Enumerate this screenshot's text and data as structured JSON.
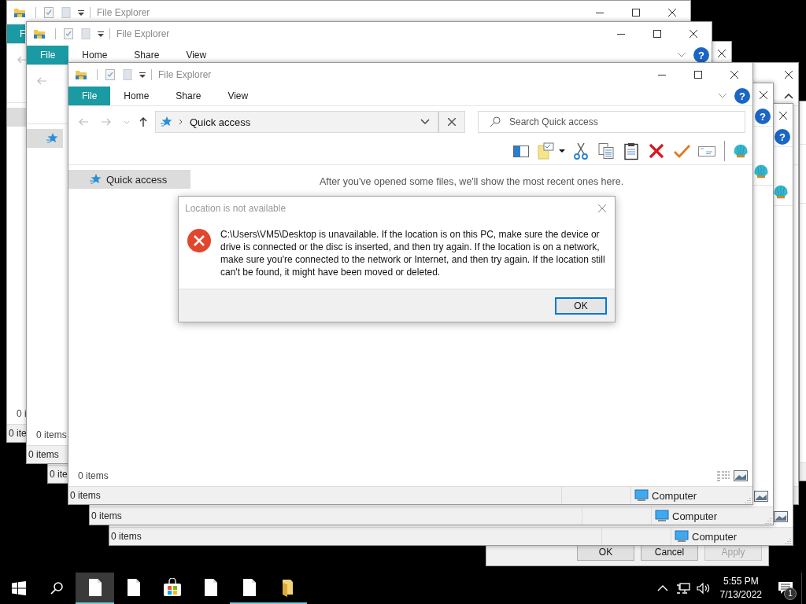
{
  "desktop": {
    "windows": [
      {
        "kind": "explorer",
        "title": "File Explorer",
        "min_button": true,
        "max_button": true,
        "close_button": true,
        "tabs": [
          {
            "label": "File",
            "selected": true
          },
          {
            "label": "Home",
            "selected": false
          },
          {
            "label": "Share",
            "selected": false
          },
          {
            "label": "View",
            "selected": false
          }
        ],
        "ribbon_collapse": true,
        "help": "?",
        "back_button": true,
        "address": "Quick access",
        "search": {
          "placeholder": "Search Quick access"
        },
        "toolbar": [
          {
            "kind": "preview-pane"
          },
          {
            "kind": "folder-note"
          },
          {
            "kind": "caret"
          },
          {
            "kind": "scissors"
          },
          {
            "kind": "copy"
          },
          {
            "kind": "paste"
          },
          {
            "kind": "delete"
          },
          {
            "kind": "check"
          },
          {
            "kind": "envelope"
          },
          {
            "kind": "separator"
          },
          {
            "kind": "shell"
          }
        ],
        "sidebar": {
          "label": "Quick access",
          "selected": true,
          "icon": true
        },
        "message": "After you've opened some files, we'll show the most recent ones here.",
        "content_status": "0 items",
        "details_icon": true,
        "image_icon": true,
        "status": "0 items",
        "computer": "Computer",
        "resize_grip": true
      },
      {
        "kind": "explorer",
        "close_button": true,
        "help": "?",
        "toolbar": [
          {
            "kind": "shell"
          }
        ],
        "image_icon": true,
        "status": "0 items",
        "computer": "Computer",
        "resize_grip": true
      },
      {
        "kind": "explorer",
        "close_button": true,
        "help": "?",
        "toolbar": [
          {
            "kind": "shell"
          }
        ],
        "image_icon": true,
        "status": "0 items",
        "computer": "Computer",
        "resize_grip": true
      },
      {
        "kind": "explorer",
        "title": "File Explorer",
        "min_button": true,
        "max_button": true,
        "close_button": true,
        "tabs": [
          {
            "label": "File",
            "selected": true
          },
          {
            "label": "Home",
            "selected": false
          },
          {
            "label": "Share",
            "selected": false
          },
          {
            "label": "View",
            "selected": false
          }
        ],
        "ribbon_collapse": true,
        "help": "?",
        "back_button": true,
        "sidebar": {
          "selected": true,
          "icon": true
        },
        "content_status": "0 items",
        "status": "0 items"
      },
      {
        "kind": "explorer",
        "title": "File Explorer",
        "min_button": true,
        "max_button": true,
        "close_button": true,
        "tabs": [
          {
            "label": "F",
            "selected": true
          }
        ],
        "back_button": true,
        "sidebar": {
          "selected": true,
          "icon": false
        },
        "content_status": "0 i",
        "status": "0 ite"
      },
      {
        "kind": "explorer",
        "close_button": true,
        "status": "0 ite"
      },
      {
        "kind": "properties",
        "buttons": [
          {
            "label": "OK",
            "disabled": false
          },
          {
            "label": "Cancel",
            "disabled": false
          },
          {
            "label": "Apply",
            "disabled": true
          }
        ]
      },
      {
        "kind": "explorer",
        "close_button": true,
        "ribbon_expand": true
      },
      {
        "kind": "explorer"
      }
    ]
  },
  "dialog": {
    "title": "Location is not available",
    "message": "C:\\Users\\VM5\\Desktop is unavailable. If the location is on this PC, make sure the device or drive is connected or the disc is inserted, and then try again. If the location is on a network, make sure you're connected to the network or Internet, and then try again. If the location still can't be found, it might have been moved or deleted.",
    "button": "OK"
  },
  "taskbar": {
    "apps": [
      {
        "kind": "document",
        "selected": true,
        "running": true
      },
      {
        "kind": "document",
        "selected": false,
        "running": false
      },
      {
        "kind": "store",
        "selected": false,
        "running": false
      },
      {
        "kind": "document",
        "selected": false,
        "running": false
      },
      {
        "kind": "document",
        "selected": false,
        "running": true
      },
      {
        "kind": "folder",
        "selected": false,
        "running": true
      }
    ],
    "time": "5:55 PM",
    "date": "7/13/2022",
    "notifications": "1"
  }
}
